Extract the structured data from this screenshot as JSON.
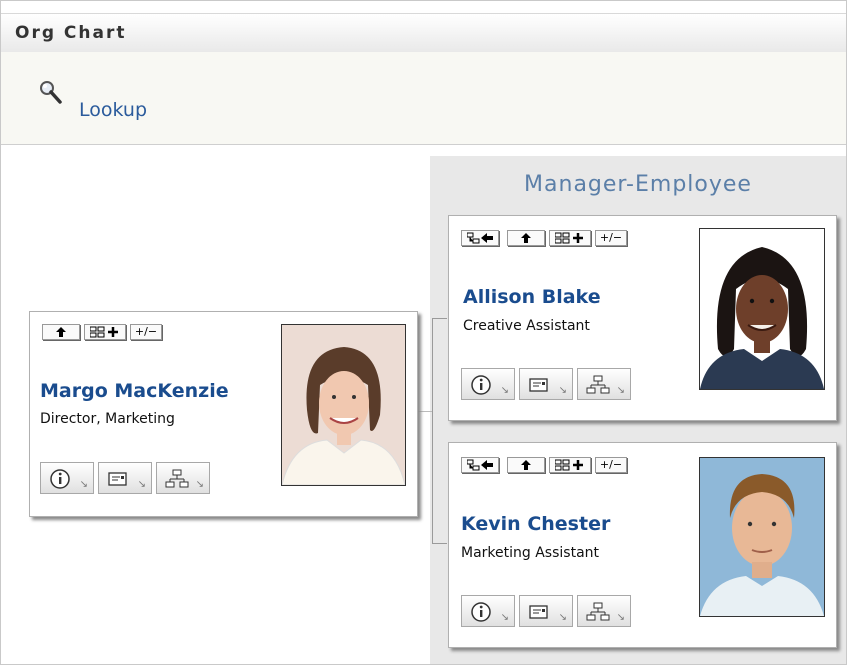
{
  "window": {
    "title": "Org Chart"
  },
  "lookup": {
    "label": "Lookup",
    "icon": "magnifier-icon"
  },
  "group": {
    "title": "Manager-Employee"
  },
  "manager": {
    "name": "Margo MacKenzie",
    "title": "Director, Marketing",
    "photo": "portrait-woman-brown-hair",
    "actions": [
      "up-icon",
      "expand-icon",
      "toggle-icon"
    ]
  },
  "employees": [
    {
      "name": "Allison Blake",
      "title": "Creative Assistant",
      "photo": "portrait-woman-dark-hair",
      "actions": [
        "collapse-icon",
        "up-icon",
        "expand-icon",
        "toggle-icon"
      ]
    },
    {
      "name": "Kevin Chester",
      "title": "Marketing Assistant",
      "photo": "portrait-man-brown-hair",
      "actions": [
        "collapse-icon",
        "up-icon",
        "expand-icon",
        "toggle-icon"
      ]
    }
  ],
  "buttons": {
    "toggle_label": "+/−"
  }
}
